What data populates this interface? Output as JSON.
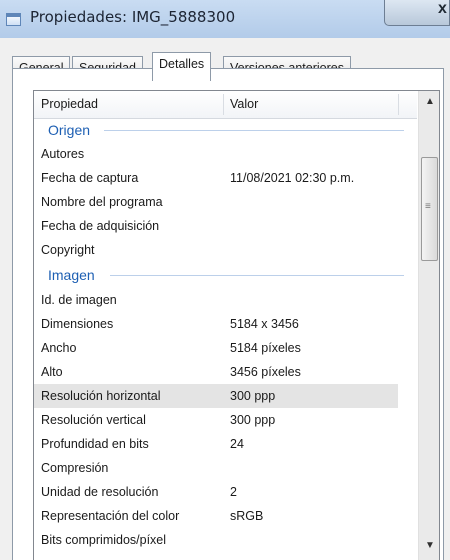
{
  "window": {
    "title": "Propiedades: IMG_5888300",
    "close_glyph": "x"
  },
  "tabs": [
    {
      "label": "General"
    },
    {
      "label": "Seguridad"
    },
    {
      "label": "Detalles"
    },
    {
      "label": "Versiones anteriores"
    }
  ],
  "active_tab": "Detalles",
  "list": {
    "headers": {
      "property": "Propiedad",
      "value": "Valor"
    },
    "groups": [
      {
        "name": "Origen",
        "rows": [
          {
            "property": "Autores",
            "value": ""
          },
          {
            "property": "Fecha de captura",
            "value": "11/08/2021 02:30 p.m."
          },
          {
            "property": "Nombre del programa",
            "value": ""
          },
          {
            "property": "Fecha de adquisición",
            "value": ""
          },
          {
            "property": "Copyright",
            "value": ""
          }
        ]
      },
      {
        "name": "Imagen",
        "rows": [
          {
            "property": "Id. de imagen",
            "value": ""
          },
          {
            "property": "Dimensiones",
            "value": "5184 x 3456"
          },
          {
            "property": "Ancho",
            "value": "5184 píxeles"
          },
          {
            "property": "Alto",
            "value": "3456 píxeles"
          },
          {
            "property": "Resolución horizontal",
            "value": "300 ppp"
          },
          {
            "property": "Resolución vertical",
            "value": "300 ppp"
          },
          {
            "property": "Profundidad en bits",
            "value": "24"
          },
          {
            "property": "Compresión",
            "value": ""
          },
          {
            "property": "Unidad de resolución",
            "value": "2"
          },
          {
            "property": "Representación del color",
            "value": "sRGB"
          },
          {
            "property": "Bits comprimidos/píxel",
            "value": ""
          }
        ]
      }
    ],
    "selected_property": "Resolución horizontal"
  },
  "scrollbar": {
    "up_icon": "scroll-up-arrow",
    "down_icon": "scroll-down-arrow",
    "position_fraction": 0.13
  },
  "colors": {
    "group_header": "#1d5fb3",
    "selected_row": "#e4e4e4",
    "title_bar": "#c9dcf2"
  }
}
